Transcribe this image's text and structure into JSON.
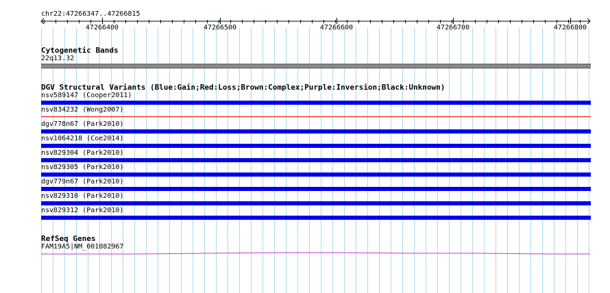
{
  "ruler": {
    "position_label": "chr22:47266347..47266815",
    "range": [
      47266347,
      47266815
    ],
    "tick_labels": [
      "47266400",
      "47266500",
      "47266600",
      "47266700",
      "47266800"
    ]
  },
  "tracks": {
    "cytoband": {
      "title": "Cytogenetic Bands",
      "band_label": "22q13.32",
      "band_color": "#8a8a8a"
    },
    "dgv": {
      "title": "DGV Structural Variants (Blue:Gain;Red:Loss;Brown:Complex;Purple:Inversion;Black:Unknown)",
      "colors": {
        "gain": "#0000ee",
        "loss": "#ee0000"
      },
      "features": [
        {
          "label": "nsv589147 (Cooper2011)",
          "type": "gain"
        },
        {
          "label": "nsv834232 (Wong2007)",
          "type": "loss"
        },
        {
          "label": "dgv778n67 (Park2010)",
          "type": "gain"
        },
        {
          "label": "nsv1064218 (Coe2014)",
          "type": "gain"
        },
        {
          "label": "nsv829304 (Park2010)",
          "type": "gain"
        },
        {
          "label": "nsv829305 (Park2010)",
          "type": "gain"
        },
        {
          "label": "dgv779n67 (Park2010)",
          "type": "gain"
        },
        {
          "label": "nsv829310 (Park2010)",
          "type": "gain"
        },
        {
          "label": "nsv829312 (Park2010)",
          "type": "gain"
        }
      ]
    },
    "refseq": {
      "title": "RefSeq Genes",
      "gene_label": "FAM19A5|NM_001082967",
      "gene_color": "#cc33cc"
    }
  },
  "grid_color": "#a7dbe8"
}
